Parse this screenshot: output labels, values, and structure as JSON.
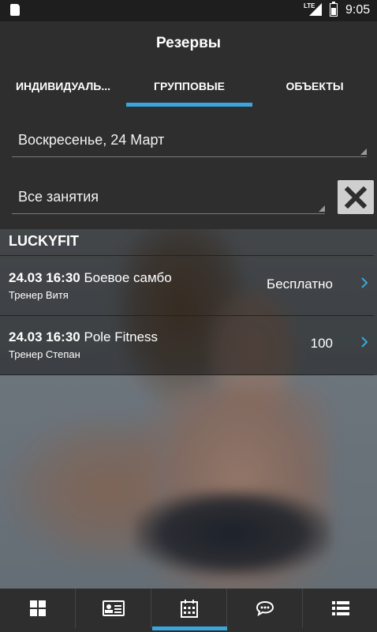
{
  "status_bar": {
    "network": "LTE",
    "time": "9:05"
  },
  "app_bar": {
    "title": "Резервы"
  },
  "tabs": [
    {
      "label": "ИНДИВИДУАЛЬ...",
      "active": false
    },
    {
      "label": "ГРУППОВЫЕ",
      "active": true
    },
    {
      "label": "ОБЪЕКТЫ",
      "active": false
    }
  ],
  "filters": {
    "date": "Воскресенье, 24 Март",
    "class_type": "Все занятия",
    "clear_icon": "close-icon"
  },
  "studio": {
    "name": "LUCKYFIT"
  },
  "sessions": [
    {
      "datetime": "24.03 16:30",
      "name": "Боевое самбо",
      "trainer": "Тренер Витя",
      "price": "Бесплатно"
    },
    {
      "datetime": "24.03 16:30",
      "name": "Pole Fitness",
      "trainer": "Тренер Степан",
      "price": "100"
    }
  ],
  "bottom_nav": [
    {
      "icon": "grid-icon",
      "active": false
    },
    {
      "icon": "id-card-icon",
      "active": false
    },
    {
      "icon": "calendar-icon",
      "active": true
    },
    {
      "icon": "chat-icon",
      "active": false
    },
    {
      "icon": "list-icon",
      "active": false
    }
  ],
  "colors": {
    "accent": "#39a7dd",
    "background": "#2e2e2e",
    "status_bar": "#1e1e1e"
  }
}
